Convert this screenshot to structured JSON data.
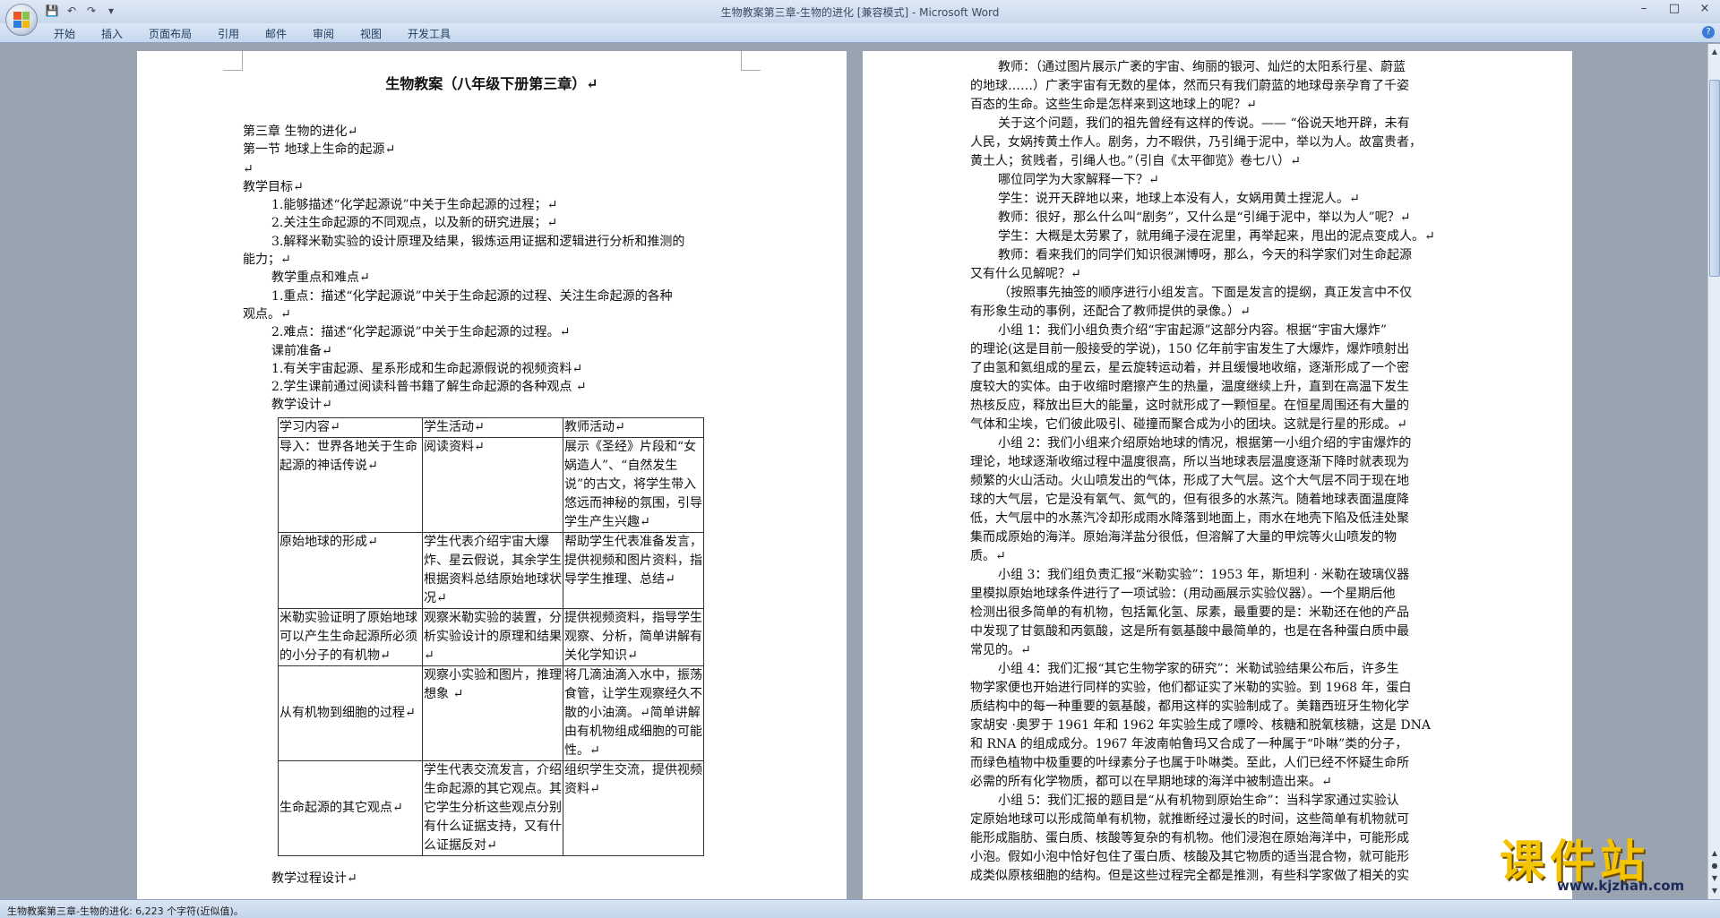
{
  "window": {
    "title": "生物教案第三章-生物的进化 [兼容模式] - Microsoft Word",
    "controls": [
      "–",
      "□",
      "×"
    ]
  },
  "qat": [
    "save-icon",
    "undo-icon",
    "redo-icon",
    "customize-icon"
  ],
  "ribbon": {
    "tabs": [
      "开始",
      "插入",
      "页面布局",
      "引用",
      "邮件",
      "审阅",
      "视图",
      "开发工具"
    ]
  },
  "page1": {
    "title": "生物教案（八年级下册第三章）↵",
    "lines": [
      "第三章  生物的进化↵",
      "第一节  地球上生命的起源↵",
      "↵",
      "教学目标↵",
      "1.能够描述“化学起源说”中关于生命起源的过程；↵",
      "2.关注生命起源的不同观点，以及新的研究进展；↵",
      "3.解释米勒实验的设计原理及结果，锻炼运用证据和逻辑进行分析和推测的",
      "能力；↵",
      "教学重点和难点↵",
      "1.重点：描述“化学起源说”中关于生命起源的过程、关注生命起源的各种",
      "观点。↵",
      "2.难点：描述“化学起源说”中关于生命起源的过程。↵",
      "课前准备↵",
      "1.有关宇宙起源、星系形成和生命起源假说的视频资料↵",
      "2.学生课前通过阅读科普书籍了解生命起源的各种观点  ↵",
      "教学设计↵"
    ],
    "table": {
      "headers": [
        "学习内容↵",
        "学生活动↵",
        "教师活动↵"
      ],
      "rows": [
        [
          "导入：世界各地关于生命起源的神话传说↵",
          "阅读资料↵",
          "展示《圣经》片段和“女娲造人”、“自然发生说”的古文，将学生带入悠远而神秘的氛围，引导学生产生兴趣↵"
        ],
        [
          "原始地球的形成↵",
          "学生代表介绍宇宙大爆炸、星云假说，其余学生根据资料总结原始地球状况↵",
          "帮助学生代表准备发言，提供视频和图片资料，指导学生推理、总结↵"
        ],
        [
          "米勒实验证明了原始地球可以产生生命起源所必须的小分子的有机物↵",
          "观察米勒实验的装置，分析实验设计的原理和结果↵",
          "提供视频资料，指导学生观察、分析，简单讲解有关化学知识↵"
        ],
        [
          "从有机物到细胞的过程↵",
          "观察小实验和图片，推理想象 ↵",
          "将几滴油滴入水中，振荡食管，让学生观察经久不散的小油滴。↵简单讲解由有机物组成细胞的可能性。↵"
        ],
        [
          "生命起源的其它观点↵",
          "      学生代表交流发言，介绍生命起源的其它观点。其它学生分析这些观点分别有什么证据支持，又有什么证据反对↵",
          "组织学生交流，提供视频资料↵"
        ]
      ]
    },
    "after_table": "教学过程设计↵"
  },
  "page2": {
    "lines": [
      "教师：（通过图片展示广袤的宇宙、绚丽的银河、灿烂的太阳系行星、蔚蓝",
      "的地球……）广袤宇宙有无数的星体，然而只有我们蔚蓝的地球母亲孕育了千姿",
      "百态的生命。这些生命是怎样来到这地球上的呢？↵",
      "关于这个问题，我们的祖先曾经有这样的传说。—— “俗说天地开辟，未有",
      "人民，女娲抟黄土作人。剧务，力不暇供，乃引绳于泥中，举以为人。故富贵者，",
      "黄土人；贫贱者，引绳人也。”（引自《太平御览》卷七八）↵",
      "哪位同学为大家解释一下？↵",
      "学生：说开天辟地以来，地球上本没有人，女娲用黄土捏泥人。↵",
      "教师：很好，那么什么叫“剧务”，又什么是“引绳于泥中，举以为人”呢？↵",
      "学生：大概是太劳累了，就用绳子浸在泥里，再举起来，甩出的泥点变成人。↵",
      "教师：看来我们的同学们知识很渊博呀，那么，今天的科学家们对生命起源",
      "又有什么见解呢？↵",
      "（按照事先抽签的顺序进行小组发言。下面是发言的提纲，真正发言中不仅",
      "有形象生动的事例，还配合了教师提供的录像。）↵",
      "小组 1：我们小组负责介绍“宇宙起源”这部分内容。根据“宇宙大爆炸”",
      "的理论(这是目前一般接受的学说)，150 亿年前宇宙发生了大爆炸，爆炸喷射出",
      "了由氢和氦组成的星云，星云旋转运动着，并且缓慢地收缩，逐渐形成了一个密",
      "度较大的实体。由于收缩时磨擦产生的热量，温度继续上升，直到在高温下发生",
      "热核反应，释放出巨大的能量，这时就形成了一颗恒星。在恒星周围还有大量的",
      "气体和尘埃，它们彼此吸引、碰撞而聚合成为小的团块。这就是行星的形成。↵",
      "小组 2：我们小组来介绍原始地球的情况，根据第一小组介绍的宇宙爆炸的",
      "理论，地球逐渐收缩过程中温度很高，所以当地球表层温度逐渐下降时就表现为",
      "频繁的火山活动。火山喷发出的气体，形成了大气层。这个大气层不同于现在地",
      "球的大气层，它是没有氧气、氮气的，但有很多的水蒸汽。随着地球表面温度降",
      "低，大气层中的水蒸汽冷却形成雨水降落到地面上，雨水在地壳下陷及低洼处聚",
      "集而成原始的海洋。原始海洋盐分很低，但溶解了大量的甲烷等火山喷发的物",
      "质。↵",
      "小组 3：我们组负责汇报“米勒实验”：1953 年，斯坦利 · 米勒在玻璃仪器",
      "里模拟原始地球条件进行了一项试验：(用动画展示实验仪器）。一个星期后他",
      "检测出很多简单的有机物，包括氰化氢、尿素，最重要的是：米勒还在他的产品",
      "中发现了甘氨酸和丙氨酸，这是所有氨基酸中最简单的，也是在各种蛋白质中最",
      "常见的。↵",
      "小组 4：我们汇报“其它生物学家的研究”：米勒试验结果公布后，许多生",
      "物学家便也开始进行同样的实验，他们都证实了米勒的实验。到 1968 年，蛋白",
      "质结构中的每一种重要的氨基酸，都用这样的实验制成了。美籍西班牙生物化学",
      "家胡安 ·奥罗于 1961 年和 1962 年实验生成了嘌呤、核糖和脱氧核糖，这是 DNA",
      "和 RNA 的组成成分。1967 年波南帕鲁玛又合成了一种属于“卟啉”类的分子，",
      "而绿色植物中极重要的叶绿素分子也属于卟啉类。至此，人们已经不怀疑生命所",
      "必需的所有化学物质，都可以在早期地球的海洋中被制造出来。↵",
      "小组 5：我们汇报的题目是“从有机物到原始生命”：当科学家通过实验认",
      "定原始地球可以形成简单有机物，就推断经过漫长的时间，这些简单有机物就可",
      "能形成脂肪、蛋白质、核酸等复杂的有机物。他们浸泡在原始海洋中，可能形成",
      "小泡。假如小泡中恰好包住了蛋白质、核酸及其它物质的适当混合物，就可能形",
      "成类似原核细胞的结构。但是这些过程完全都是推测，有些科学家做了相关的实"
    ]
  },
  "statusbar": {
    "text": "生物教案第三章-生物的进化: 6,223 个字符(近似值)。"
  },
  "watermark": {
    "text": "课件站",
    "url": "www.kjzhan.com"
  }
}
